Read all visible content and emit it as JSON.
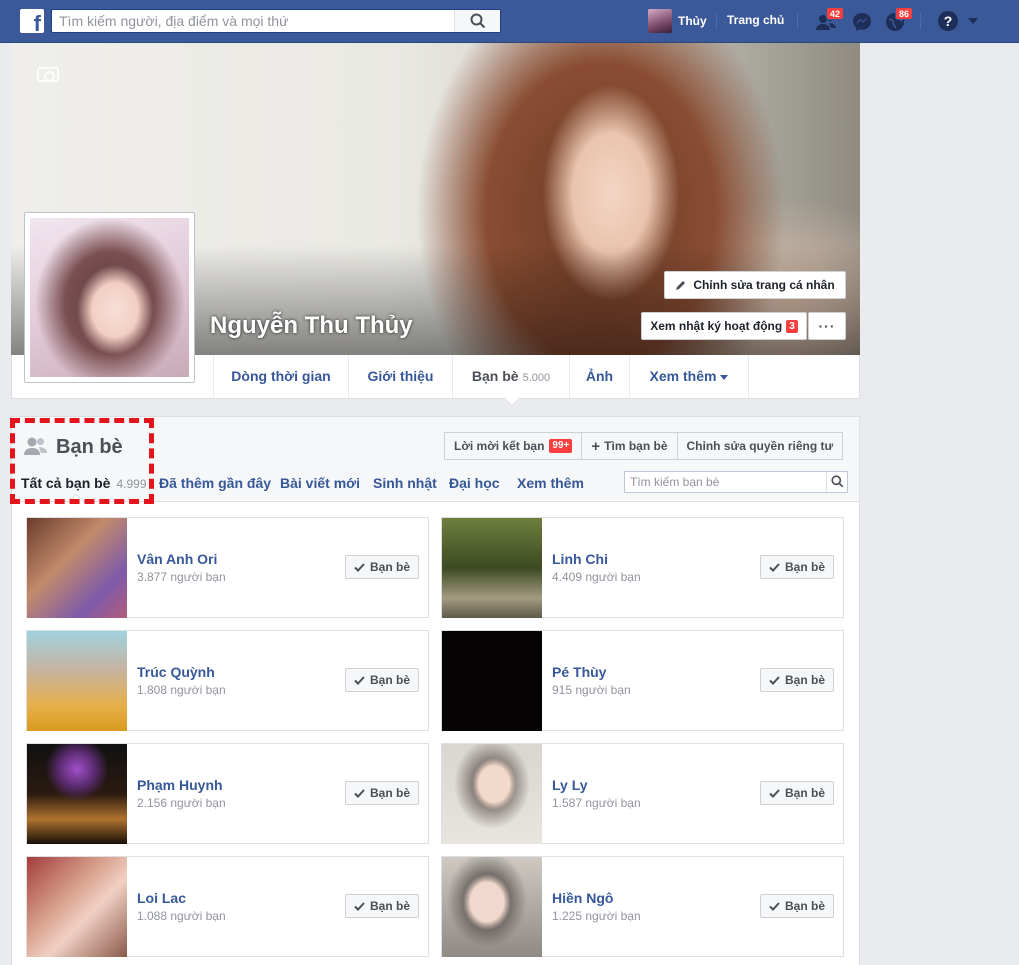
{
  "topbar": {
    "logo": "f",
    "search_placeholder": "Tìm kiếm người, địa điểm và mọi thứ",
    "user_name": "Thủy",
    "home_label": "Trang chủ",
    "friend_requests_badge": "42",
    "notifications_badge": "86",
    "help_glyph": "?"
  },
  "profile": {
    "name": "Nguyễn Thu Thủy",
    "edit_button": "Chỉnh sửa trang cá nhân",
    "activity_log_button": "Xem nhật ký hoạt động",
    "activity_log_badge": "3",
    "more_button": "···"
  },
  "tabs": [
    {
      "label": "Dòng thời gian"
    },
    {
      "label": "Giới thiệu"
    },
    {
      "label": "Bạn bè",
      "count": "5.000"
    },
    {
      "label": "Ảnh"
    },
    {
      "label": "Xem thêm"
    }
  ],
  "friends": {
    "title": "Bạn bè",
    "requests_button": "Lời mời kết bạn",
    "requests_badge": "99+",
    "find_button": "Tìm bạn bè",
    "privacy_button": "Chỉnh sửa quyền riêng tư",
    "subnav": [
      {
        "label": "Tất cả bạn bè",
        "count": "4.999"
      },
      {
        "label": "Đã thêm gần đây"
      },
      {
        "label": "Bài viết mới"
      },
      {
        "label": "Sinh nhật"
      },
      {
        "label": "Đại học"
      },
      {
        "label": "Xem thêm"
      }
    ],
    "search_placeholder": "Tìm kiếm bạn bè",
    "friend_button_label": "Bạn bè",
    "list": [
      {
        "name": "Vân Anh Ori",
        "mutual": "3.877 người bạn"
      },
      {
        "name": "Linh Chi",
        "mutual": "4.409 người bạn"
      },
      {
        "name": "Trúc Quỳnh",
        "mutual": "1.808 người bạn"
      },
      {
        "name": "Pé Thùy",
        "mutual": "915 người bạn"
      },
      {
        "name": "Phạm Huynh",
        "mutual": "2.156 người bạn"
      },
      {
        "name": "Ly Ly",
        "mutual": "1.587 người bạn"
      },
      {
        "name": "Loi Lac",
        "mutual": "1.088 người bạn"
      },
      {
        "name": "Hiền Ngô",
        "mutual": "1.225 người bạn"
      }
    ]
  },
  "colors": {
    "brand_blue": "#3b5998",
    "link_blue": "#365899",
    "badge_red": "#fa3e3e",
    "highlight_red": "#e3141b"
  }
}
